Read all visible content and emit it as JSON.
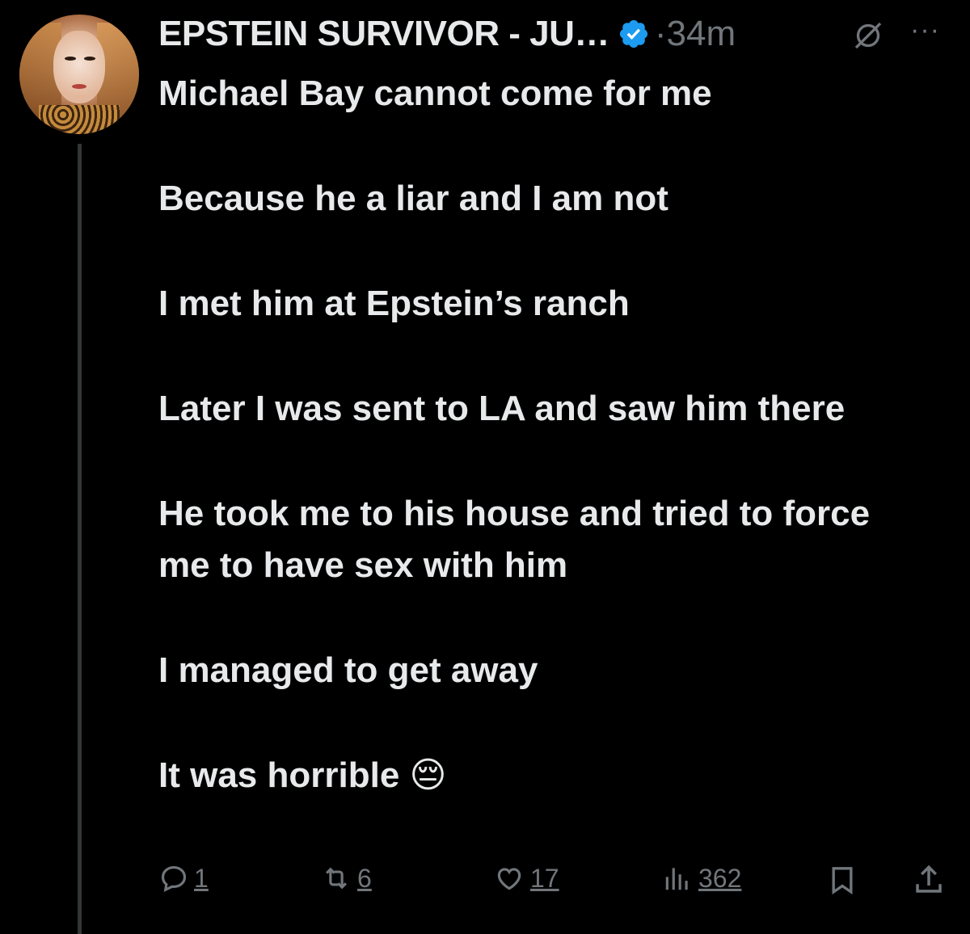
{
  "post": {
    "author_name": "EPSTEIN SURVIVOR - JU…",
    "separator": "·",
    "time": "34m",
    "more_label": "···",
    "lines": [
      "Michael Bay cannot come for me",
      "Because he a liar and I am not",
      "I met him at Epstein’s ranch",
      "Later I was sent to LA and saw him there",
      "He took me to his house and tried to force me to have sex with him",
      "I managed to get away",
      "It was horrible 😔"
    ]
  },
  "actions": {
    "replies": "1",
    "reposts": "6",
    "likes": "17",
    "views": "362"
  },
  "colors": {
    "background": "#000000",
    "text": "#e7e9ea",
    "muted": "#71767b",
    "verified": "#1d9bf0",
    "thread_line": "#333639"
  },
  "icons": [
    "verified-badge-icon",
    "grok-icon",
    "more-icon",
    "reply-icon",
    "repost-icon",
    "like-icon",
    "views-icon",
    "bookmark-icon",
    "share-icon"
  ]
}
